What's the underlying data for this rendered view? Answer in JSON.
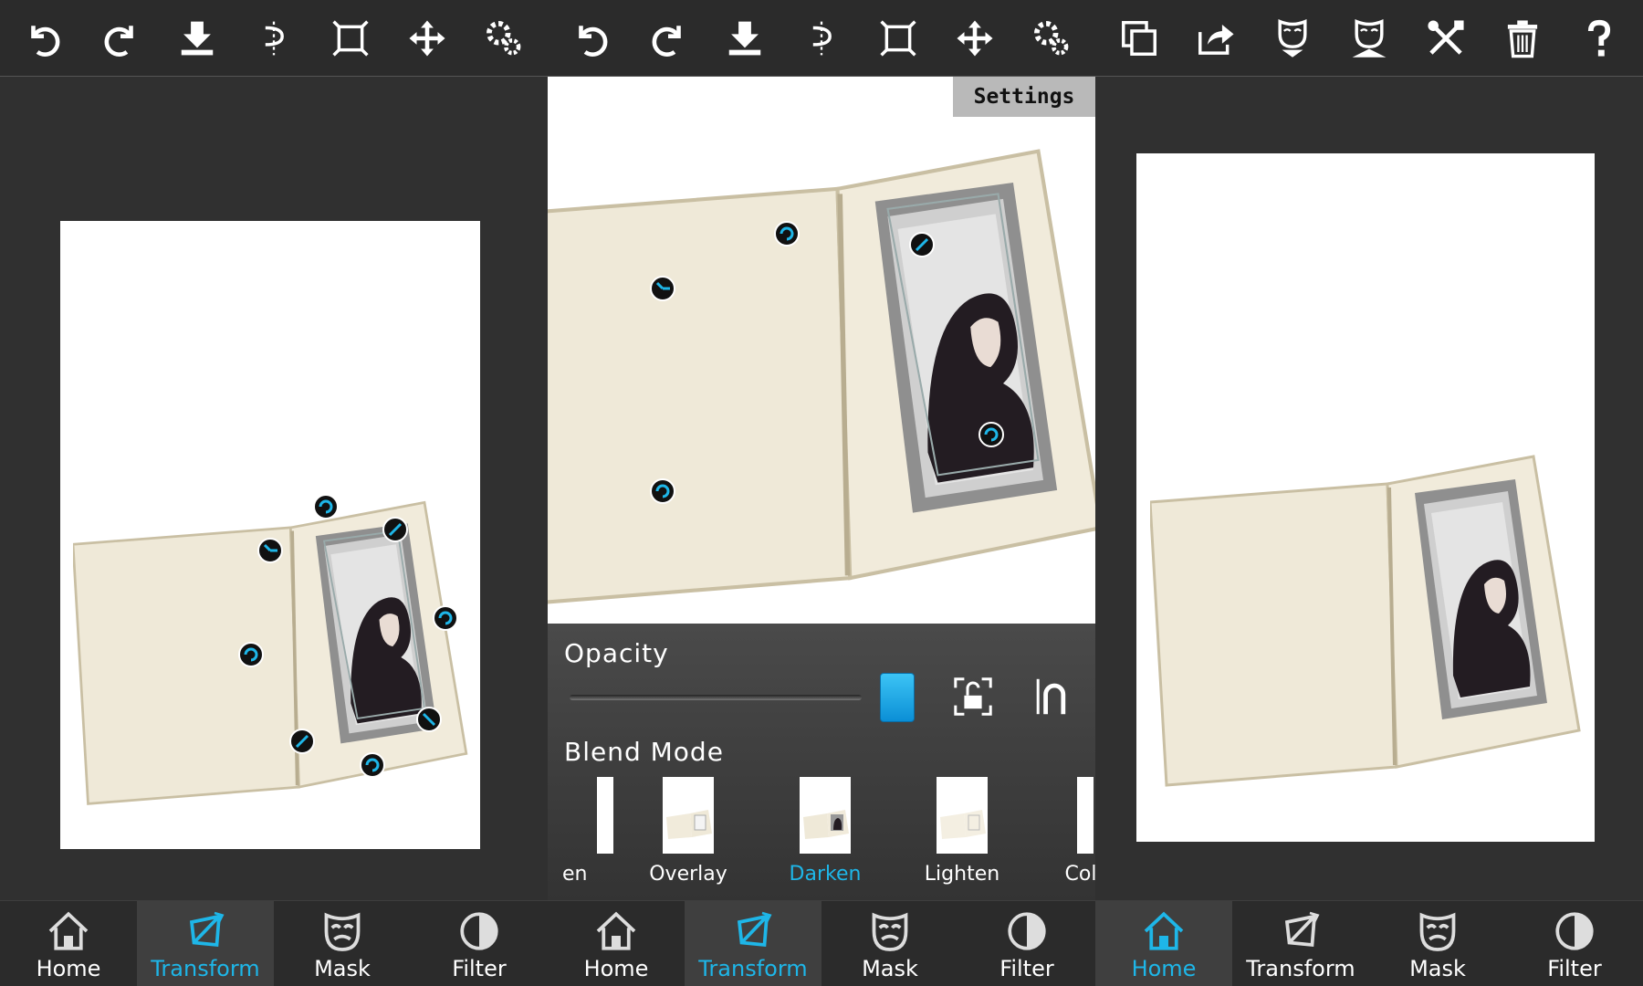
{
  "colors": {
    "accent": "#1eb6e8",
    "bar": "#2b2b2b",
    "background": "#303030"
  },
  "screens": [
    {
      "id": "transform-editor",
      "toolbar": [
        "undo-icon",
        "redo-icon",
        "save-download-icon",
        "flip-icon",
        "crop-fit-icon",
        "move-icon",
        "settings-gear-icon"
      ],
      "nav": [
        {
          "label": "Home",
          "icon": "home-icon",
          "active": false
        },
        {
          "label": "Transform",
          "icon": "transform-icon",
          "active": true
        },
        {
          "label": "Mask",
          "icon": "mask-icon",
          "active": false
        },
        {
          "label": "Filter",
          "icon": "filter-icon",
          "active": false
        }
      ]
    },
    {
      "id": "layer-settings",
      "toolbar": [
        "undo-icon",
        "redo-icon",
        "save-download-icon",
        "flip-icon",
        "crop-fit-icon",
        "move-icon",
        "settings-gear-icon"
      ],
      "settings_tab": "Settings",
      "opacity": {
        "label": "Opacity",
        "value": 1.0
      },
      "blend": {
        "label": "Blend Mode",
        "modes": [
          "en",
          "Overlay",
          "Darken",
          "Lighten",
          "Color"
        ],
        "selected": "Darken"
      },
      "nav": [
        {
          "label": "Home",
          "icon": "home-icon",
          "active": false
        },
        {
          "label": "Transform",
          "icon": "transform-icon",
          "active": true
        },
        {
          "label": "Mask",
          "icon": "mask-icon",
          "active": false
        },
        {
          "label": "Filter",
          "icon": "filter-icon",
          "active": false
        }
      ]
    },
    {
      "id": "home-preview",
      "toolbar": [
        "duplicate-icon",
        "share-icon",
        "mask-down-icon",
        "mask-up-icon",
        "tools-icon",
        "trash-icon",
        "help-icon"
      ],
      "nav": [
        {
          "label": "Home",
          "icon": "home-icon",
          "active": true
        },
        {
          "label": "Transform",
          "icon": "transform-icon",
          "active": false
        },
        {
          "label": "Mask",
          "icon": "mask-icon",
          "active": false
        },
        {
          "label": "Filter",
          "icon": "filter-icon",
          "active": false
        }
      ]
    }
  ]
}
